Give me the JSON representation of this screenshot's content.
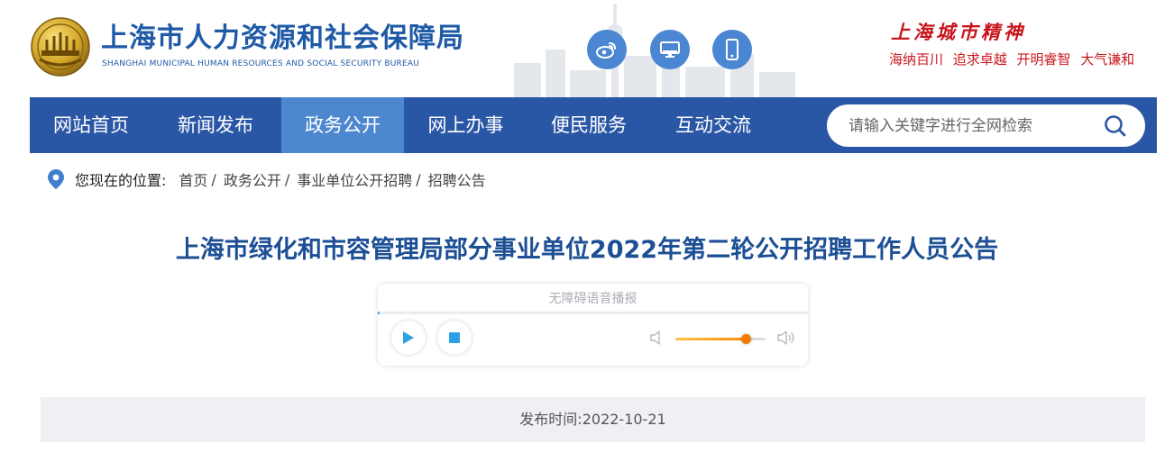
{
  "header": {
    "site_name": "上海市人力资源和社会保障局",
    "site_name_en": "SHANGHAI MUNICIPAL HUMAN RESOURCES AND SOCIAL SECURITY BUREAU",
    "social_icons": [
      "weibo-icon",
      "desktop-icon",
      "mobile-icon"
    ],
    "spirit_title": "上海城市精神",
    "spirit_line": "海纳百川 追求卓越 开明睿智 大气谦和"
  },
  "nav": {
    "items": [
      "网站首页",
      "新闻发布",
      "政务公开",
      "网上办事",
      "便民服务",
      "互动交流"
    ],
    "active_index": 2,
    "search_placeholder": "请输入关键字进行全网检索"
  },
  "breadcrumb": {
    "prefix": "您现在的位置:",
    "items": [
      "首页",
      "政务公开",
      "事业单位公开招聘",
      "招聘公告"
    ]
  },
  "article": {
    "title": "上海市绿化和市容管理局部分事业单位2022年第二轮公开招聘工作人员公告"
  },
  "player": {
    "label": "无障碍语音播报",
    "volume": 0.78
  },
  "meta": {
    "publish_label": "发布时间:",
    "publish_date": "2022-10-21"
  },
  "colors": {
    "nav_bg": "#2a57a5",
    "nav_active": "#4d87cf",
    "title_blue": "#1c4f95",
    "spirit_red": "#c8161d",
    "social_blue": "#4a86d1"
  }
}
